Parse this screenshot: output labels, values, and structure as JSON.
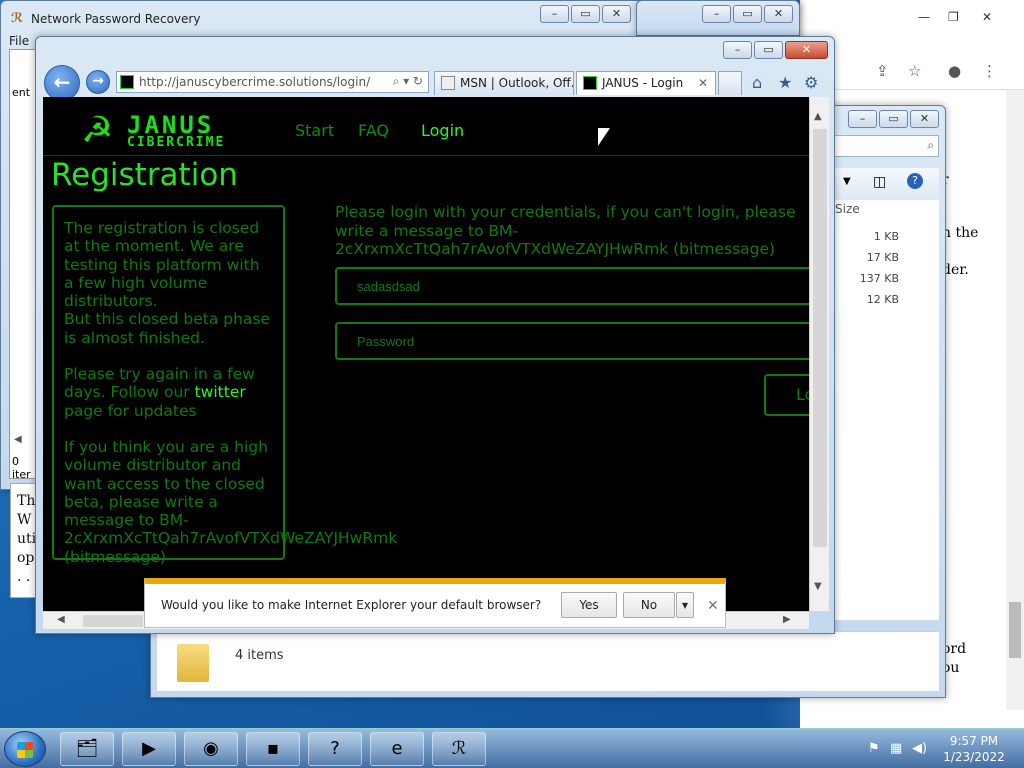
{
  "npr_window": {
    "title": "Network Password Recovery",
    "menu": "File",
    "list_header": "ent",
    "status": "0 iter"
  },
  "doc_left": {
    "lines": [
      "Th",
      "W",
      "uti",
      "op",
      ". ."
    ]
  },
  "chrome_window": {
    "partial_text": [
      "r",
      "n the",
      "der.",
      "ord",
      "ou"
    ]
  },
  "explorer": {
    "column_size": "Size",
    "sizes": [
      "1 KB",
      "17 KB",
      "137 KB",
      "12 KB"
    ],
    "item_count": "4 items"
  },
  "ie": {
    "url": "http://januscybercrime.solutions/login/",
    "tabs": [
      {
        "label": "MSN | Outlook, Off...",
        "active": false
      },
      {
        "label": "JANUS - Login",
        "active": true
      }
    ]
  },
  "janus": {
    "logo_top": "JANUS",
    "logo_bottom": "CIBERCRIME",
    "nav": [
      "Start",
      "FAQ",
      "Login"
    ],
    "active_nav": "Login",
    "title": "Registration",
    "reg_p1": "The registration is closed at the moment. We are testing this platform with a few high volume distributors.",
    "reg_p1b": "But this closed beta phase is almost finished.",
    "reg_p2a": "Please try again in a few days. Follow our",
    "reg_p2_link": "twitter",
    "reg_p2b": "page for updates",
    "reg_p3": "If you think you are a high volume distributor and want access to the closed beta, please write a message to BM-",
    "reg_p3_addr": "2cXrxmXcTtQah7rAvofVTXdWeZAYJHwRmk",
    "reg_p3_end": "(bitmessage)",
    "login_msg": "Please login with your credentials, if you can't login, please write a message to BM-2cXrxmXcTtQah7rAvofVTXdWeZAYJHwRmk (bitmessage)",
    "username_value": "sadasdsad",
    "password_placeholder": "Password",
    "login_button": "Lo"
  },
  "notification": {
    "question": "Would you like to make Internet Explorer your default browser?",
    "yes": "Yes",
    "no": "No"
  },
  "taskbar": {
    "time": "9:57 PM",
    "date": "1/23/2022"
  }
}
